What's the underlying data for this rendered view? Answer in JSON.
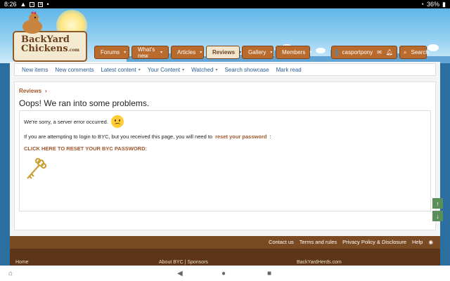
{
  "status_bar": {
    "time": "8:26",
    "battery": "36%"
  },
  "logo": {
    "line1": "BackYard",
    "line2": "Chickens",
    "suffix": ".com"
  },
  "nav": {
    "items": [
      {
        "label": "Forums"
      },
      {
        "label": "What's new"
      },
      {
        "label": "Articles"
      },
      {
        "label": "Reviews"
      },
      {
        "label": "Gallery"
      },
      {
        "label": "Members"
      }
    ],
    "user": "casportpony",
    "search": "Search"
  },
  "subnav": {
    "items": [
      "New items",
      "New comments",
      "Latest content",
      "Your Content",
      "Watched",
      "Search showcase",
      "Mark read"
    ]
  },
  "breadcrumb": "Reviews",
  "title": "Oops! We ran into some problems.",
  "message": {
    "line1": "We're sorry, a server error occurred.",
    "line2_pre": "If you are attempting to login to BYC, but you received this page, you will need to",
    "line2_link": "reset your password",
    "line2_post": ":",
    "cta": "CLICK HERE TO RESET YOUR BYC PASSWORD:"
  },
  "footer": {
    "links": [
      "Contact us",
      "Terms and rules",
      "Privacy Policy & Disclosure",
      "Help"
    ],
    "bottom": [
      "Home",
      "About BYC | Sponsors",
      "BackYardHerds.com"
    ]
  },
  "colors": {
    "brand_brown": "#b96a2d",
    "link": "#a0562a",
    "sky": "#5fb6e8"
  }
}
